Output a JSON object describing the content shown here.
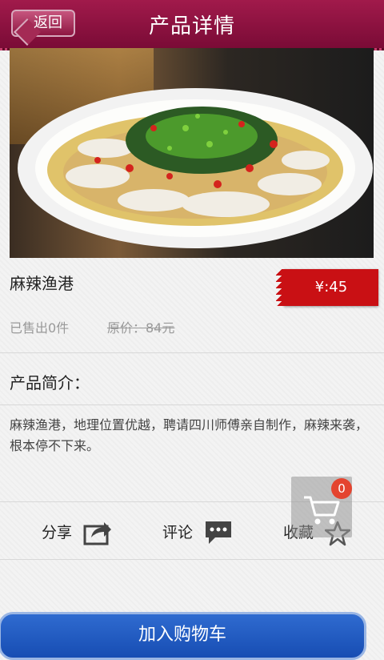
{
  "header": {
    "title": "产品详情",
    "back_label": "返回"
  },
  "product": {
    "name": "麻辣渔港",
    "price": "¥:45",
    "sold": "已售出0件",
    "original_price": "原价：84元",
    "intro_label": "产品简介：",
    "intro_text": "麻辣渔港，地理位置优越，聘请四川师傅亲自制作，麻辣来袭，根本停不下来。"
  },
  "actions": {
    "share": "分享",
    "comment": "评论",
    "favorite": "收藏"
  },
  "cart": {
    "count": "0"
  },
  "bottom": {
    "add_to_cart": "加入购物车"
  },
  "colors": {
    "header": "#8e1342",
    "price": "#c91014",
    "button": "#2563c8"
  }
}
